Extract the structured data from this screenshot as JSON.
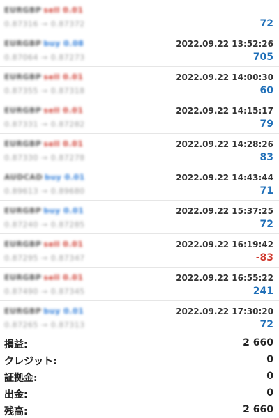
{
  "trades": [
    {
      "pair": "EURGBP",
      "action": "sell 0.01",
      "side": "sell",
      "prices": "0.87316 → 0.87372",
      "time": "",
      "profit": "72",
      "sign": "pos"
    },
    {
      "pair": "EURGBP",
      "action": "buy 0.08",
      "side": "buy",
      "prices": "0.87064 → 0.87273",
      "time": "2022.09.22 13:52:26",
      "profit": "705",
      "sign": "pos"
    },
    {
      "pair": "EURGBP",
      "action": "sell 0.01",
      "side": "sell",
      "prices": "0.87355 → 0.87318",
      "time": "2022.09.22 14:00:30",
      "profit": "60",
      "sign": "pos"
    },
    {
      "pair": "EURGBP",
      "action": "sell 0.01",
      "side": "sell",
      "prices": "0.87331 → 0.87282",
      "time": "2022.09.22 14:15:17",
      "profit": "79",
      "sign": "pos"
    },
    {
      "pair": "EURGBP",
      "action": "sell 0.01",
      "side": "sell",
      "prices": "0.87330 → 0.87278",
      "time": "2022.09.22 14:28:26",
      "profit": "83",
      "sign": "pos"
    },
    {
      "pair": "AUDCAD",
      "action": "buy 0.01",
      "side": "buy",
      "prices": "0.89613 → 0.89680",
      "time": "2022.09.22 14:43:44",
      "profit": "71",
      "sign": "pos"
    },
    {
      "pair": "EURGBP",
      "action": "buy 0.01",
      "side": "buy",
      "prices": "0.87240 → 0.87285",
      "time": "2022.09.22 15:37:25",
      "profit": "72",
      "sign": "pos"
    },
    {
      "pair": "EURGBP",
      "action": "sell 0.01",
      "side": "sell",
      "prices": "0.87295 → 0.87347",
      "time": "2022.09.22 16:19:42",
      "profit": "-83",
      "sign": "neg"
    },
    {
      "pair": "EURGBP",
      "action": "sell 0.01",
      "side": "sell",
      "prices": "0.87490 → 0.87345",
      "time": "2022.09.22 16:55:22",
      "profit": "241",
      "sign": "pos"
    },
    {
      "pair": "EURGBP",
      "action": "buy 0.01",
      "side": "buy",
      "prices": "0.87265 → 0.87313",
      "time": "2022.09.22 17:30:20",
      "profit": "72",
      "sign": "pos"
    }
  ],
  "summary": [
    {
      "label": "損益:",
      "value": "2 660"
    },
    {
      "label": "クレジット:",
      "value": "0"
    },
    {
      "label": "証拠金:",
      "value": "0"
    },
    {
      "label": "出金:",
      "value": "0"
    },
    {
      "label": "残高:",
      "value": "2 660"
    }
  ],
  "colors": {
    "buy": "#2b7bd9",
    "sell": "#d03a2f",
    "profit_pos": "#1f6fb8",
    "profit_neg": "#d03a2f"
  }
}
